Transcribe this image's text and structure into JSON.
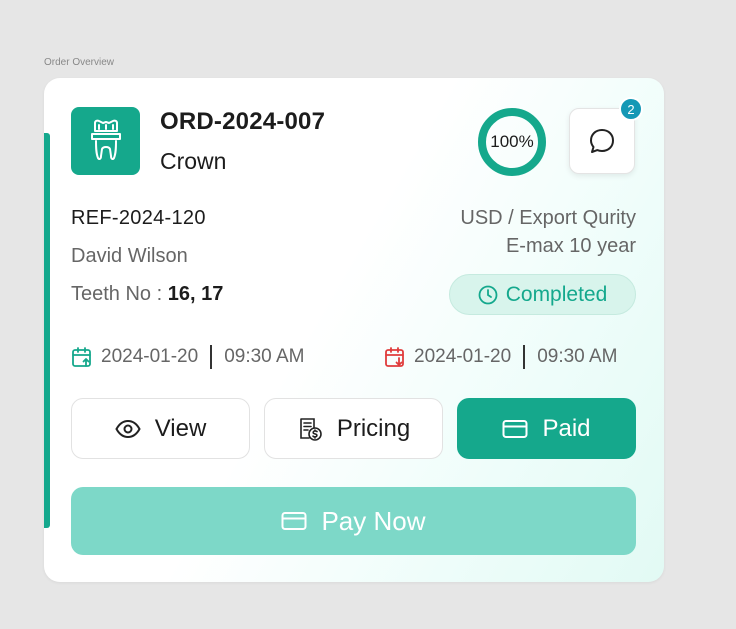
{
  "frame": {
    "label": "Order Overview"
  },
  "order": {
    "id": "ORD-2024-007",
    "product": "Crown",
    "progress_label": "100%",
    "progress": 1.0,
    "messages_count": "2",
    "reference": "REF-2024-120",
    "patient": "David Wilson",
    "teeth_label": "Teeth No : ",
    "teeth_value": "16, 17",
    "currency_line": "USD / Export Qurity",
    "warranty_line": "E-max 10 year",
    "status": "Completed"
  },
  "dates": {
    "start": {
      "date": "2024-01-20",
      "time": "09:30 AM"
    },
    "end": {
      "date": "2024-01-20",
      "time": "09:30 AM"
    }
  },
  "actions": {
    "view_label": "View",
    "pricing_label": "Pricing",
    "paid_label": "Paid",
    "pay_now_label": "Pay Now"
  },
  "icons": {
    "product": "tooth-crown-icon",
    "chat": "chat-bubble-icon",
    "status": "clock-icon",
    "start_date": "calendar-arrow-up-icon",
    "end_date": "calendar-arrow-down-icon",
    "view": "eye-icon",
    "pricing": "invoice-dollar-icon",
    "paid": "credit-card-icon",
    "pay_now": "credit-card-icon"
  },
  "colors": {
    "accent": "#15a88c",
    "accent_light": "#7dd8c8",
    "badge": "#1598b5",
    "start_date_icon": "#15a88c",
    "end_date_icon": "#e03c3c"
  }
}
